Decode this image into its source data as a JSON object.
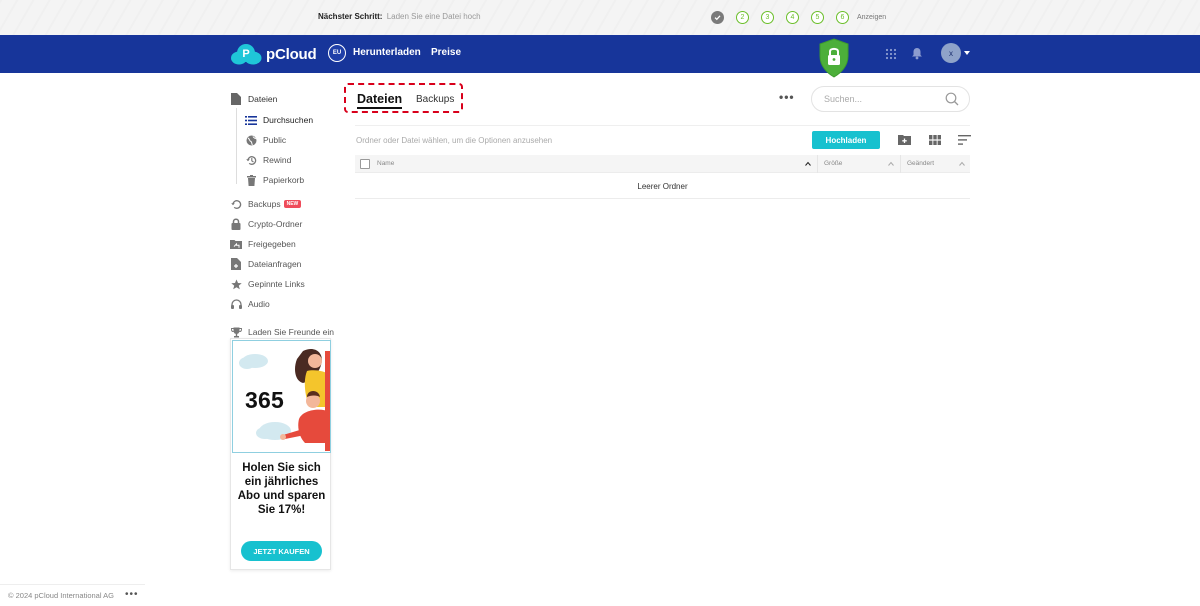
{
  "stepbar": {
    "label": "Nächster Schritt:",
    "sub": "Laden Sie eine Datei hoch",
    "steps": [
      "2",
      "3",
      "4",
      "5",
      "6"
    ],
    "show_label": "Anzeigen"
  },
  "header": {
    "logo_text": "pCloud",
    "eu_label": "EU",
    "nav_download": "Herunterladen",
    "nav_prices": "Preise",
    "avatar_initial": "x",
    "color": "#17359a"
  },
  "sidebar": {
    "files": "Dateien",
    "browse": "Durchsuchen",
    "public": "Public",
    "rewind": "Rewind",
    "trash": "Papierkorb",
    "backups": "Backups",
    "new_badge": "NEW",
    "crypto": "Crypto-Ordner",
    "shared": "Freigegeben",
    "file_requests": "Dateianfragen",
    "pinned_links": "Gepinnte Links",
    "audio": "Audio",
    "invite": "Laden Sie Freunde ein"
  },
  "promo": {
    "number": "365",
    "title": "Holen Sie sich ein jährliches Abo und sparen Sie 17%!",
    "button": "JETZT KAUFEN"
  },
  "footer": {
    "copyright": "© 2024 pCloud International AG",
    "more": "•••"
  },
  "main": {
    "tab_files": "Dateien",
    "tab_backups": "Backups",
    "more": "•••",
    "search_placeholder": "Suchen...",
    "hint": "Ordner oder Datei wählen, um die Optionen anzusehen",
    "upload": "Hochladen",
    "columns": {
      "name": "Name",
      "size": "Größe",
      "modified": "Geändert"
    },
    "empty": "Leerer Ordner"
  },
  "colors": {
    "accent": "#17c1cf",
    "highlight_box": "#d8001b",
    "shield": "#4caf3a"
  }
}
